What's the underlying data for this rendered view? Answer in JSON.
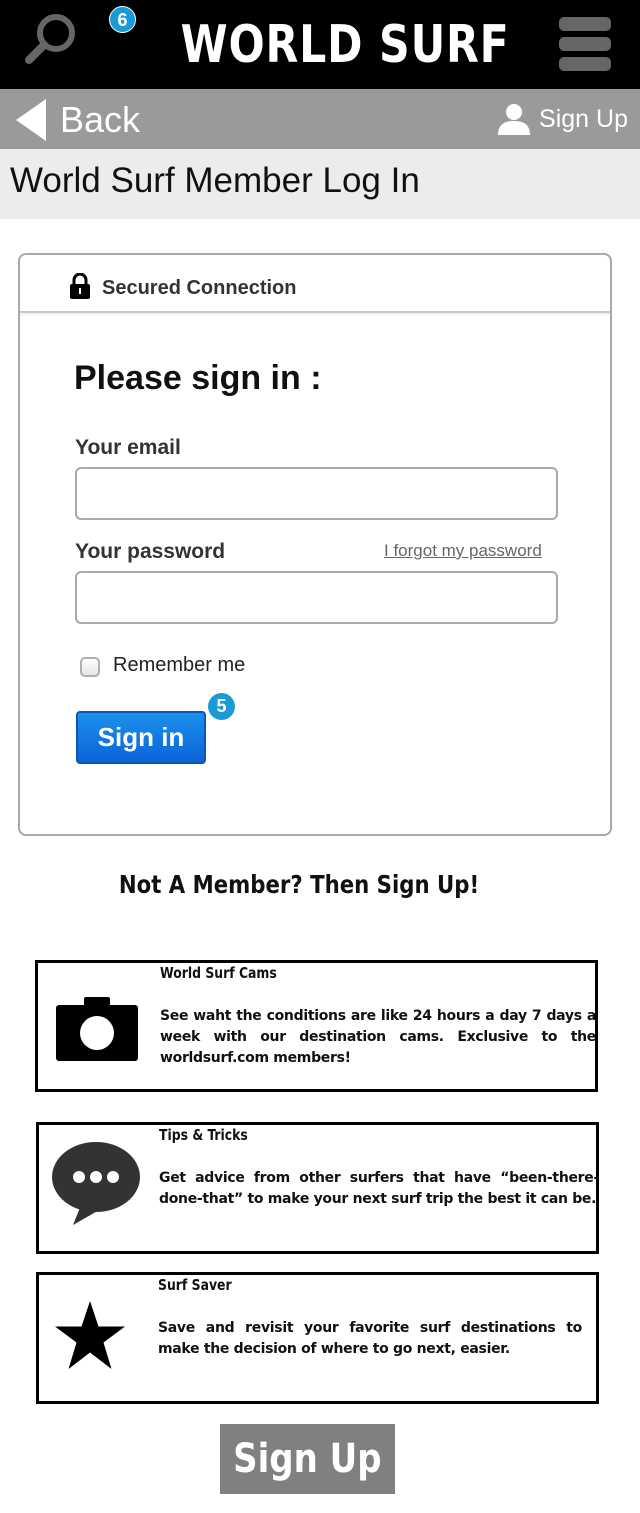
{
  "header": {
    "brand": "WORLD SURF",
    "notification_count": "6"
  },
  "nav": {
    "back_label": "Back",
    "signup_label": "Sign Up"
  },
  "page": {
    "title": "World Surf Member Log In"
  },
  "login": {
    "secured_label": "Secured Connection",
    "heading": "Please sign in :",
    "email_label": "Your email",
    "email_value": "",
    "password_label": "Your password",
    "password_value": "",
    "forgot_label": "I forgot my password",
    "remember_label": "Remember me",
    "remember_checked": false,
    "signin_label": "Sign in",
    "signin_badge": "5"
  },
  "promo": {
    "not_member": "Not A Member? Then Sign Up!"
  },
  "features": [
    {
      "title": "World Surf Cams",
      "description": "See waht the conditions are like 24 hours a day 7 days a week with our destination cams. Exclusive to the worldsurf.com members!",
      "icon": "camera-icon"
    },
    {
      "title": "Tips & Tricks",
      "description": "Get advice from other surfers that have “been-there-done-that” to make your next surf trip the best it can be.",
      "icon": "chat-bubble-icon"
    },
    {
      "title": "Surf Saver",
      "description": "Save and revisit your favorite surf destinations to make the decision of where to go next, easier.",
      "icon": "star-icon"
    }
  ],
  "footer": {
    "signup_label": "Sign Up"
  },
  "colors": {
    "topbar": "#000000",
    "navbar": "#9a9a9a",
    "badge": "#1a9bd7",
    "signin_button": "#0a64d6",
    "signup_button": "#808080"
  }
}
